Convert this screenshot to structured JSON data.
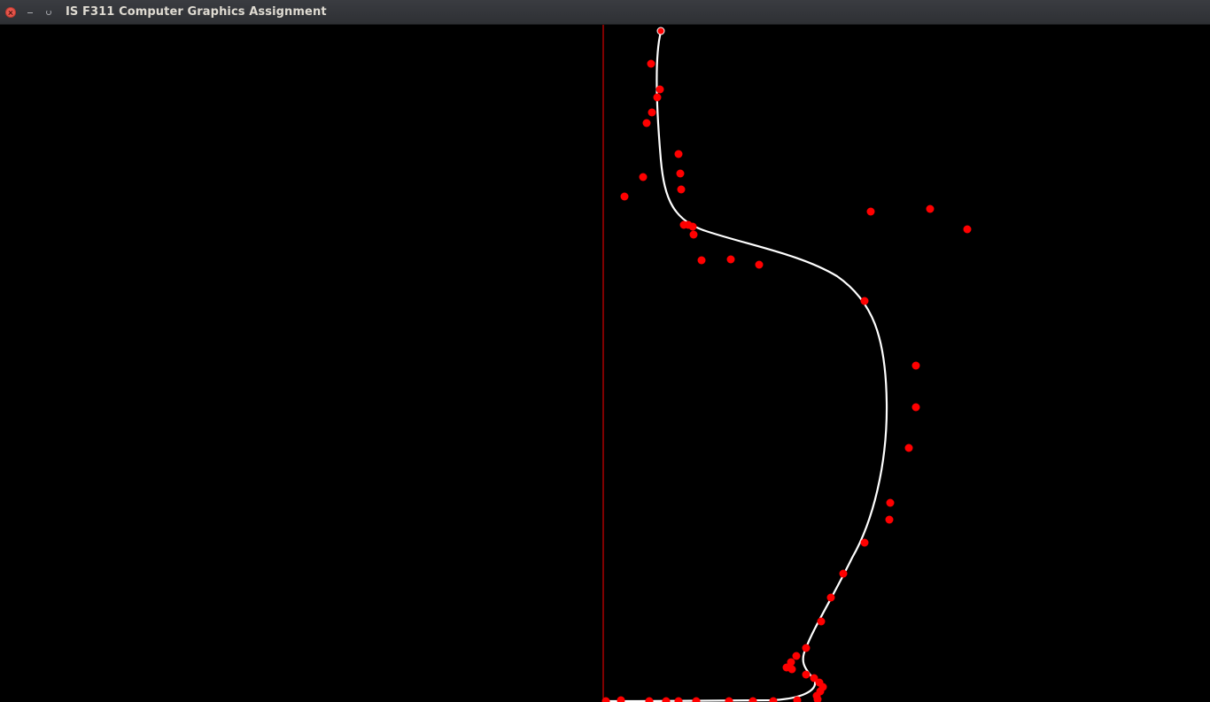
{
  "window": {
    "title": "IS F311 Computer Graphics Assignment",
    "background_color": "#000000",
    "titlebar_color": "#2e3034"
  },
  "controls": {
    "close_icon": "close-icon",
    "minimize_icon": "minimize-icon",
    "maximize_icon": "maximize-icon"
  },
  "scene": {
    "axis_color": "#ff0000",
    "control_point_color": "#ff0000",
    "curve_color": "#ffffff",
    "control_points_count": 53
  }
}
